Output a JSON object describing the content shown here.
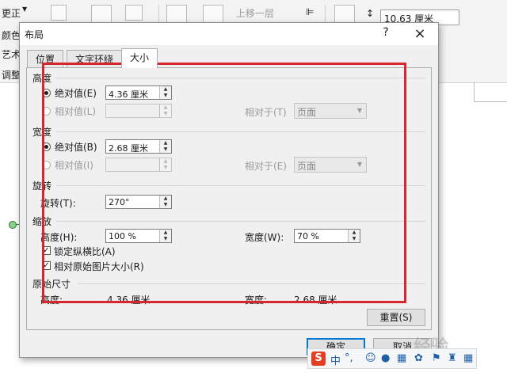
{
  "ribbon": {
    "item1": "更正",
    "item2": "颜色",
    "item3": "艺术",
    "item4": "调整",
    "move_up": "上移一层",
    "size_value": "10.63 厘米"
  },
  "dialog": {
    "title": "布局",
    "help": "?",
    "close": "×",
    "tabs": [
      "位置",
      "文字环绕",
      "大小"
    ],
    "active_tab": "大小",
    "height_section": {
      "title": "高度",
      "absolute_label": "绝对值(E)",
      "absolute_value": "4.36 厘米",
      "relative_label": "相对值(L)",
      "relative_to_label": "相对于(T)",
      "relative_to_value": "页面"
    },
    "width_section": {
      "title": "宽度",
      "absolute_label": "绝对值(B)",
      "absolute_value": "2.68 厘米",
      "relative_label": "相对值(I)",
      "relative_to_label": "相对于(E)",
      "relative_to_value": "页面"
    },
    "rotate_section": {
      "title": "旋转",
      "rotate_label": "旋转(T):",
      "rotate_value": "270°"
    },
    "scale_section": {
      "title": "缩放",
      "height_label": "高度(H):",
      "height_value": "100 %",
      "width_label": "宽度(W):",
      "width_value": "70 %",
      "lock_aspect": "锁定纵横比(A)",
      "relative_original": "相对原始图片大小(R)"
    },
    "original_section": {
      "title": "原始尺寸",
      "height_label": "高度:",
      "height_value": "4.36 厘米",
      "width_label": "宽度:",
      "width_value": "2.68 厘米"
    },
    "reset_button": "重置(S)",
    "ok_button": "确定",
    "cancel_button": "取消"
  },
  "ime": {
    "logo": "S",
    "mode": "中",
    "punct": "°,"
  },
  "watermark": "经验",
  "colors": {
    "highlight": "#d7262d",
    "primary_border": "#0078d7"
  }
}
